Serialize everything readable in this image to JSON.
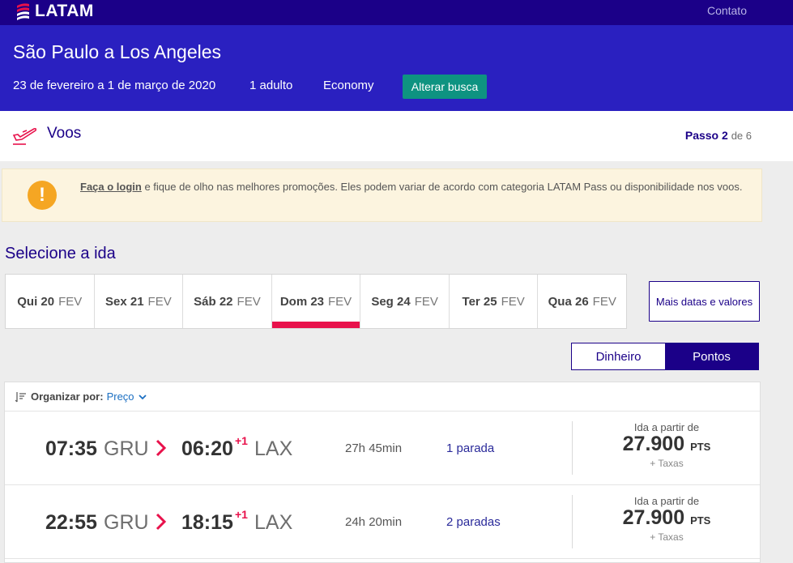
{
  "header": {
    "brand": "LATAM",
    "contact": "Contato"
  },
  "search": {
    "title": "São Paulo a Los Angeles",
    "dates": "23 de fevereiro a 1 de março de 2020",
    "passengers": "1 adulto",
    "cabin": "Economy",
    "change_button": "Alterar busca"
  },
  "steps": {
    "section": "Voos",
    "step_label": "Passo",
    "step_current": "2",
    "step_of": "de 6"
  },
  "alert": {
    "link": "Faça o login",
    "text": " e fique de olho nas melhores promoções. Eles podem variar de acordo com categoria LATAM Pass ou disponibilidade nos voos."
  },
  "select_title": "Selecione a ida",
  "dates": [
    {
      "day": "Qui 20",
      "month": "FEV"
    },
    {
      "day": "Sex 21",
      "month": "FEV"
    },
    {
      "day": "Sáb 22",
      "month": "FEV"
    },
    {
      "day": "Dom 23",
      "month": "FEV"
    },
    {
      "day": "Seg 24",
      "month": "FEV"
    },
    {
      "day": "Ter 25",
      "month": "FEV"
    },
    {
      "day": "Qua 26",
      "month": "FEV"
    }
  ],
  "more_dates": "Mais datas e valores",
  "currency_toggle": {
    "cash": "Dinheiro",
    "points": "Pontos"
  },
  "sort": {
    "label": "Organizar por:",
    "value": "Preço"
  },
  "flights": [
    {
      "dep_time": "07:35",
      "dep_code": "GRU",
      "arr_time": "06:20",
      "arr_plus": "+1",
      "arr_code": "LAX",
      "duration": "27h 45min",
      "stops": "1 parada",
      "price_caption": "Ida a partir de",
      "price": "27.900",
      "unit": "PTS",
      "taxes": "+ Taxas"
    },
    {
      "dep_time": "22:55",
      "dep_code": "GRU",
      "arr_time": "18:15",
      "arr_plus": "+1",
      "arr_code": "LAX",
      "duration": "24h 20min",
      "stops": "2 paradas",
      "price_caption": "Ida a partir de",
      "price": "27.900",
      "unit": "PTS",
      "taxes": "+ Taxas"
    }
  ]
}
